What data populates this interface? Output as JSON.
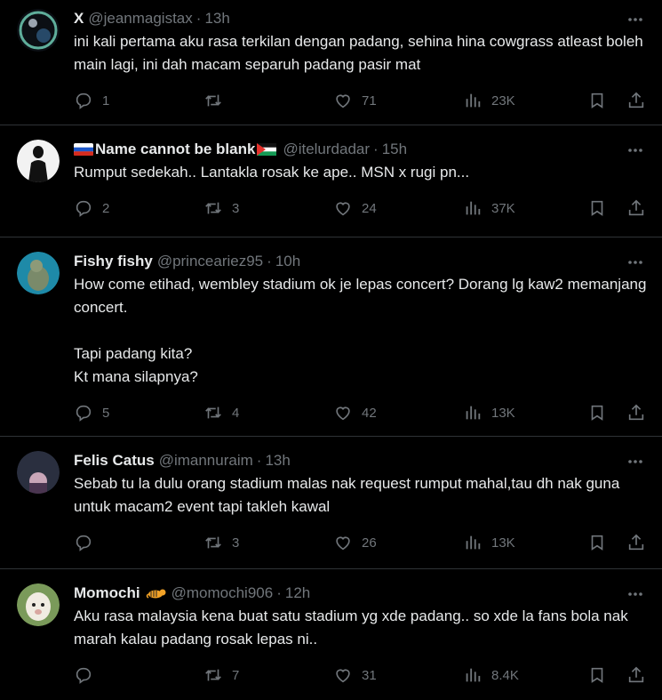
{
  "tweets": [
    {
      "name": "X",
      "handle": "@jeanmagistax",
      "time": "13h",
      "text": "ini kali pertama aku rasa terkilan dengan padang, sehina hina cowgrass atleast boleh main lagi, ini dah macam separuh padang pasir mat",
      "replies": "1",
      "retweets": "",
      "likes": "71",
      "views": "23K"
    },
    {
      "name": "Name cannot be blank",
      "handle": "@itelurdadar",
      "time": "15h",
      "text": "Rumput sedekah.. Lantakla rosak ke ape.. MSN x rugi pn...",
      "replies": "2",
      "retweets": "3",
      "likes": "24",
      "views": "37K"
    },
    {
      "name": "Fishy fishy",
      "handle": "@princeariez95",
      "time": "10h",
      "text": "How come etihad, wembley stadium ok je lepas concert? Dorang lg kaw2 memanjang concert.\n\nTapi padang kita?\nKt mana silapnya?",
      "replies": "5",
      "retweets": "4",
      "likes": "42",
      "views": "13K"
    },
    {
      "name": "Felis Catus",
      "handle": "@imannuraim",
      "time": "13h",
      "text": "Sebab tu la dulu orang stadium malas nak request rumput mahal,tau dh nak guna untuk macam2 event tapi takleh kawal",
      "replies": "",
      "retweets": "3",
      "likes": "26",
      "views": "13K"
    },
    {
      "name": "Momochi",
      "handle": "@momochi906",
      "time": "12h",
      "text": "Aku rasa malaysia kena buat satu stadium yg xde padang.. so xde la fans bola nak marah kalau padang rosak lepas ni..",
      "replies": "",
      "retweets": "7",
      "likes": "31",
      "views": "8.4K"
    }
  ],
  "colors": {
    "background": "#000000",
    "text": "#e7e9ea",
    "muted": "#71767b",
    "border": "#2f3336"
  }
}
